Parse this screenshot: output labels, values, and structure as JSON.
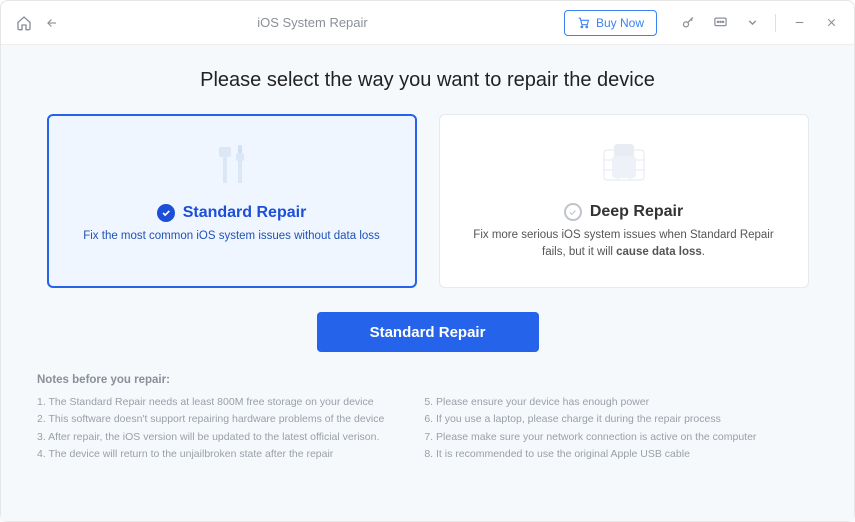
{
  "titlebar": {
    "title": "iOS System Repair",
    "buy_label": "Buy Now"
  },
  "heading": "Please select the way you want to repair the device",
  "cards": {
    "standard": {
      "title": "Standard Repair",
      "sub": "Fix the most common iOS system issues without data loss"
    },
    "deep": {
      "title": "Deep Repair",
      "sub_prefix": "Fix more serious iOS system issues when Standard Repair fails, but it will ",
      "sub_bold": "cause data loss",
      "sub_suffix": "."
    }
  },
  "primary_button": "Standard Repair",
  "notes_title": "Notes before you repair:",
  "notes_left": [
    "1.  The Standard Repair needs at least 800M free storage on your device",
    "2.  This software doesn't support repairing hardware problems of the device",
    "3.  After repair, the iOS version will be updated to the latest official verison.",
    "4.  The device will return to the unjailbroken state after the repair"
  ],
  "notes_right": [
    "5.  Please ensure your device has enough power",
    "6.  If you use a laptop, please charge it during the repair process",
    "7.  Please make sure your network connection is active on the computer",
    "8.  It is recommended to use the original Apple USB cable"
  ]
}
